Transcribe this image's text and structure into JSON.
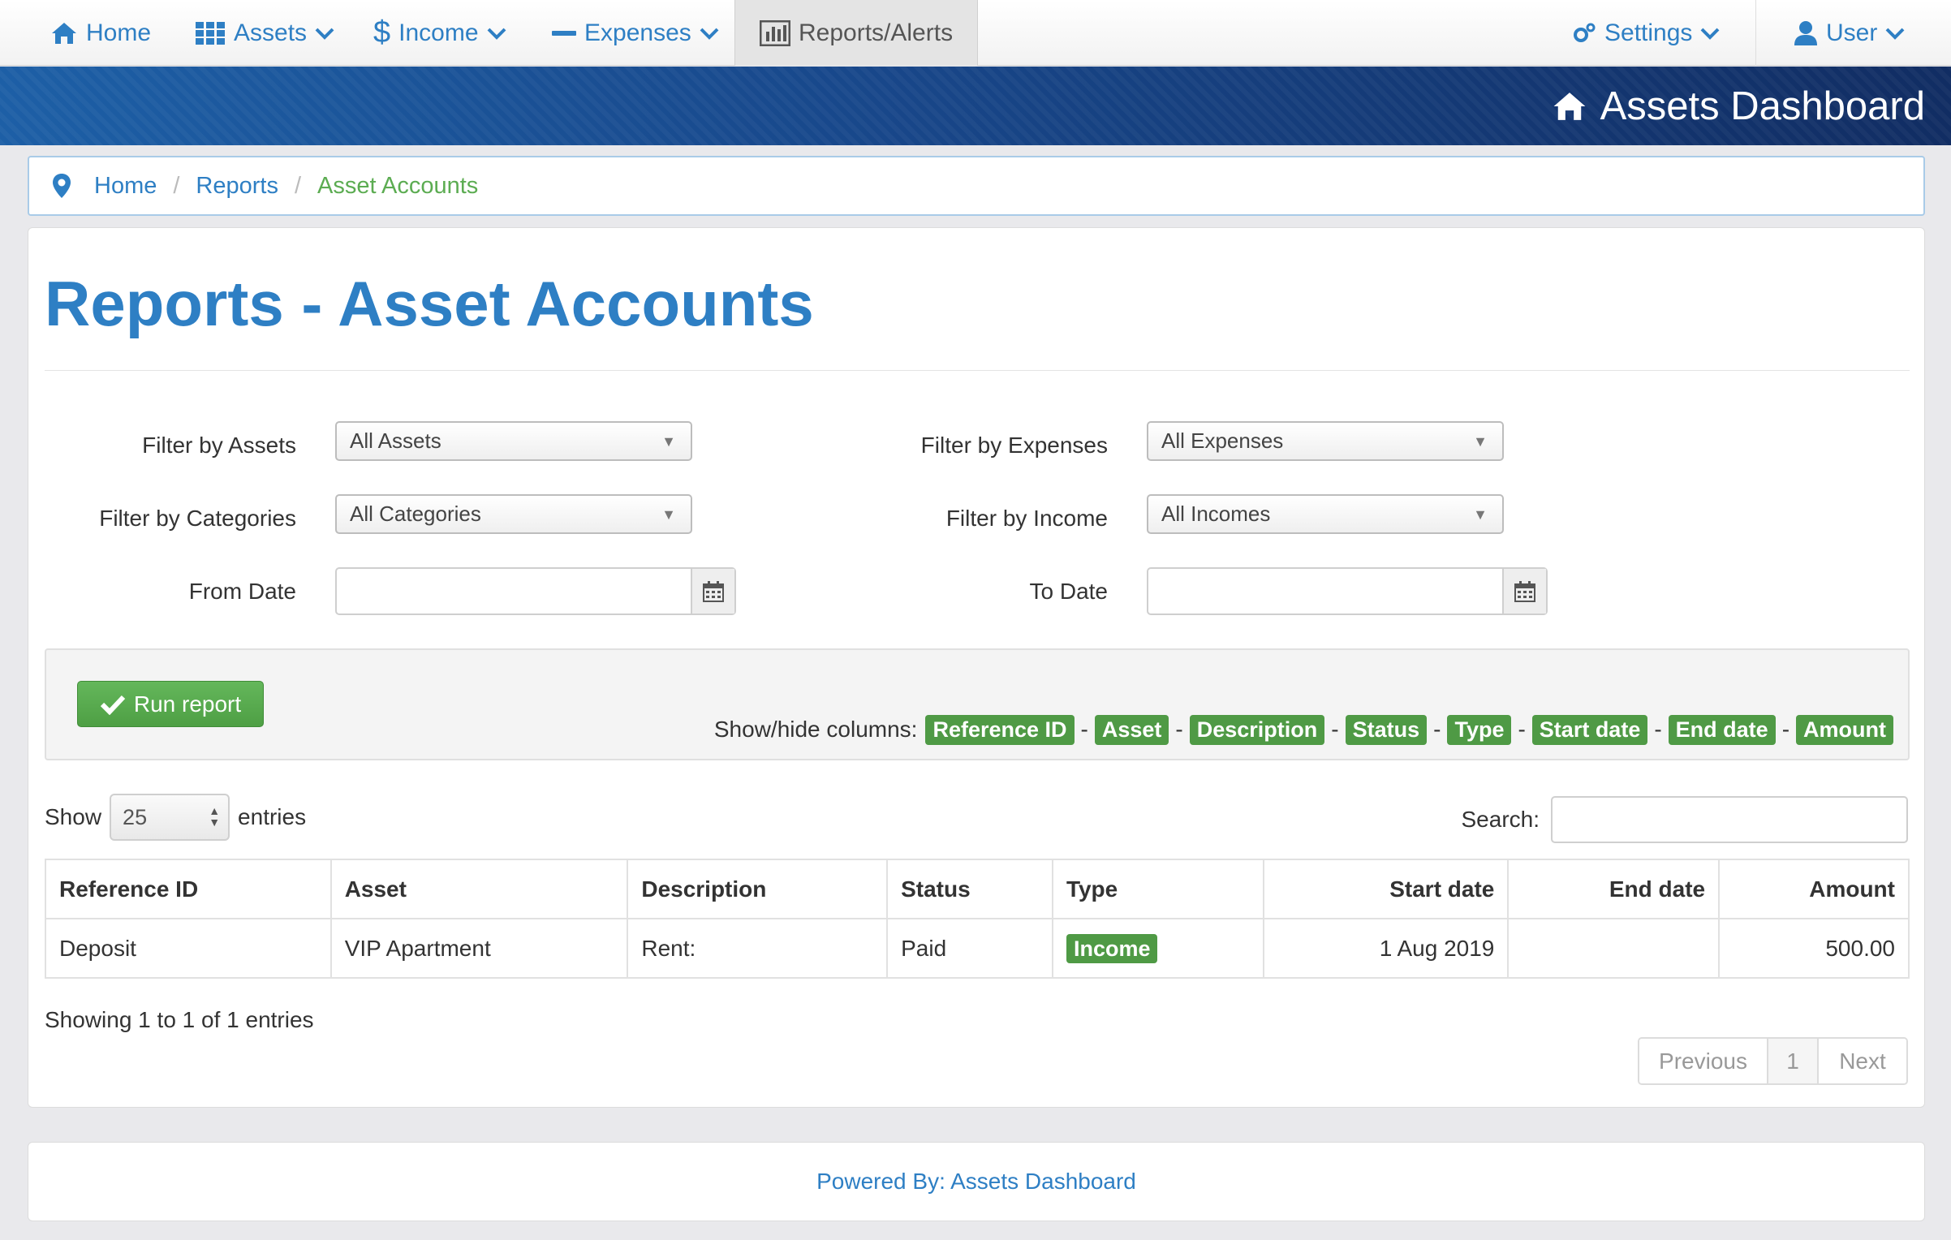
{
  "nav": {
    "home": "Home",
    "assets": "Assets",
    "income": "Income",
    "expenses": "Expenses",
    "reports": "Reports/Alerts",
    "settings": "Settings",
    "user": "User"
  },
  "banner": {
    "title": "Assets Dashboard"
  },
  "breadcrumb": {
    "home": "Home",
    "reports": "Reports",
    "current": "Asset Accounts"
  },
  "page": {
    "title": "Reports - Asset Accounts"
  },
  "filters": {
    "assets_label": "Filter by Assets",
    "assets_value": "All Assets",
    "categories_label": "Filter by Categories",
    "categories_value": "All Categories",
    "expenses_label": "Filter by Expenses",
    "expenses_value": "All Expenses",
    "income_label": "Filter by Income",
    "income_value": "All Incomes",
    "from_label": "From Date",
    "to_label": "To Date"
  },
  "actions": {
    "run_label": "Run report",
    "columns_label": "Show/hide columns:",
    "columns": [
      "Reference ID",
      "Asset",
      "Description",
      "Status",
      "Type",
      "Start date",
      "End date",
      "Amount"
    ]
  },
  "table_controls": {
    "show_label": "Show",
    "entries_value": "25",
    "entries_label": "entries",
    "search_label": "Search:"
  },
  "table": {
    "headers": [
      "Reference ID",
      "Asset",
      "Description",
      "Status",
      "Type",
      "Start date",
      "End date",
      "Amount"
    ],
    "rows": [
      [
        "Deposit",
        "VIP Apartment",
        "Rent:",
        "Paid",
        "Income",
        "1 Aug 2019",
        "",
        "500.00"
      ]
    ]
  },
  "pagination": {
    "info": "Showing 1 to 1 of 1 entries",
    "previous": "Previous",
    "current": "1",
    "next": "Next"
  },
  "footer": {
    "text": "Powered By: Assets Dashboard"
  },
  "colors": {
    "primary": "#2e7fc4",
    "success": "#4f9a45",
    "banner_dark": "#112d63"
  }
}
